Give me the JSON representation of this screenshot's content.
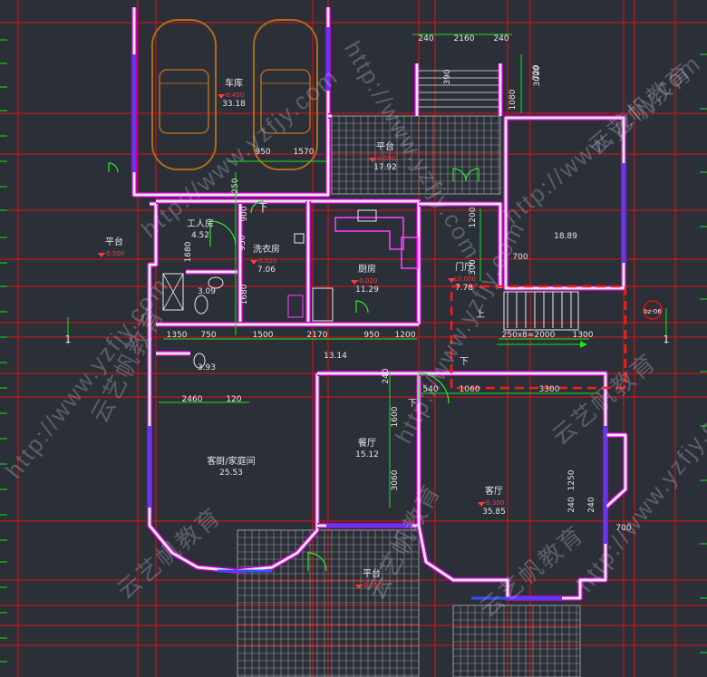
{
  "colors": {
    "background": "#2b2f38",
    "wall": "#e8e8e8",
    "wall_outline": "#c000c0",
    "axis": "#e01010",
    "dimension": "#19e619",
    "text": "#e6e6e6",
    "level": "#ff3b3b",
    "car": "#b06a1c",
    "door": "#2ee62e",
    "window": "#3a4cff",
    "stair_box": "#ff1a1a",
    "paving": "#9a9a9a"
  },
  "rooms": [
    {
      "id": "garage",
      "name": "车库",
      "area": "33.18",
      "level": "-0.450"
    },
    {
      "id": "platform-upper",
      "name": "平台",
      "area": "17.92",
      "level": "-0.050"
    },
    {
      "id": "bedroom-ne",
      "name": "",
      "area": "18.89",
      "level": ""
    },
    {
      "id": "worker-room",
      "name": "工人房",
      "area": "4.52",
      "level": ""
    },
    {
      "id": "platform-west",
      "name": "平台",
      "area": "",
      "level": "-0.500"
    },
    {
      "id": "laundry",
      "name": "洗衣房",
      "area": "7.06",
      "level": "-0.020"
    },
    {
      "id": "kitchen",
      "name": "厨房",
      "area": "11.29",
      "level": "-0.020"
    },
    {
      "id": "foyer",
      "name": "门厅",
      "area": "7.78",
      "level": "±0.000"
    },
    {
      "id": "bath-1",
      "name": "",
      "area": "3.09",
      "level": ""
    },
    {
      "id": "bath-2",
      "name": "",
      "area": "3.93",
      "level": ""
    },
    {
      "id": "corridor",
      "name": "",
      "area": "13.14",
      "level": ""
    },
    {
      "id": "dining",
      "name": "餐厅",
      "area": "15.12",
      "level": ""
    },
    {
      "id": "family-room",
      "name": "客厨/家庭间",
      "area": "25.53",
      "level": ""
    },
    {
      "id": "living-room",
      "name": "客厅",
      "area": "35.85",
      "level": "-0.300"
    },
    {
      "id": "terrace-south",
      "name": "平台",
      "area": "",
      "level": "-0.050"
    }
  ],
  "dimensions": [
    "240",
    "2160",
    "240",
    "950",
    "1570",
    "1350",
    "750",
    "1500",
    "2170",
    "950",
    "1200",
    "2460",
    "120",
    "540",
    "1060",
    "3300",
    "1300",
    "700",
    "240",
    "1600",
    "3060",
    "1250",
    "240",
    "240",
    "700",
    "720",
    "950",
    "900",
    "1680",
    "250",
    "1200",
    "300",
    "1680",
    "390",
    "1080",
    "3000",
    "250x8=2000"
  ],
  "markers": {
    "stair_up": "上",
    "stair_down": "下",
    "section_tag": "1",
    "section_label": "1",
    "north_tag": "bz-06"
  },
  "watermarks": [
    "云艺帆教育",
    "http://www.yzfjy.com"
  ]
}
